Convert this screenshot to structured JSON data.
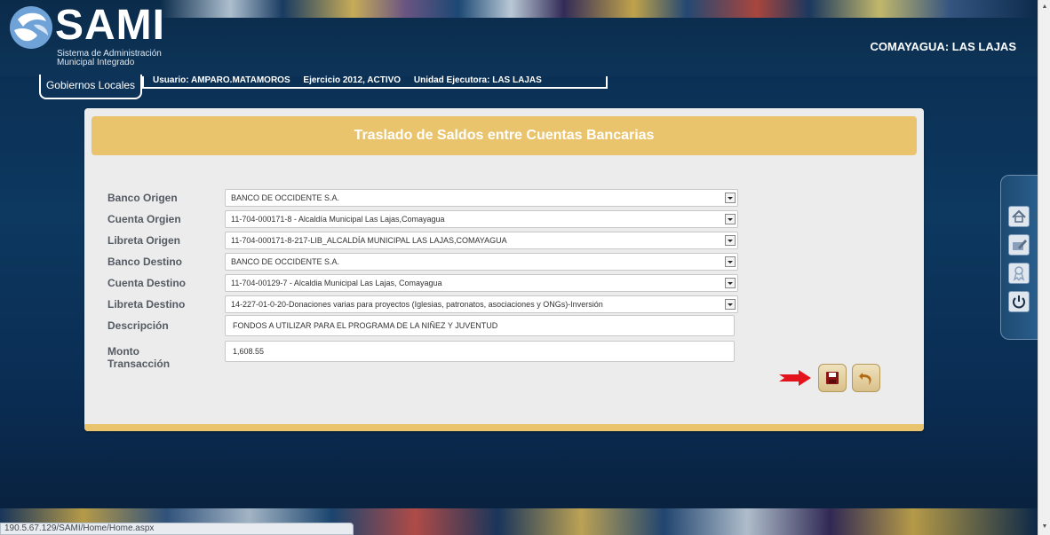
{
  "header": {
    "logo_title": "SAMI",
    "logo_subtitle_1": "Sistema de Administración",
    "logo_subtitle_2": "Municipal Integrado",
    "municipality": "COMAYAGUA: LAS LAJAS"
  },
  "nav": {
    "tab_label": "Gobiernos Locales",
    "usuario": "Usuario: AMPARO.MATAMOROS",
    "ejercicio": "Ejercicio 2012, ACTIVO",
    "unidad": "Unidad Ejecutora: LAS LAJAS"
  },
  "form": {
    "title": "Traslado de Saldos entre Cuentas Bancarias",
    "banco_origen": {
      "label": "Banco Origen",
      "value": "BANCO DE OCCIDENTE S.A."
    },
    "cuenta_origen": {
      "label": "Cuenta Orgien",
      "value": "11-704-000171-8 - Alcaldía Municipal Las Lajas,Comayagua"
    },
    "libreta_origen": {
      "label": "Libreta Origen",
      "value": "11-704-000171-8-217-LIB_ALCALDÍA MUNICIPAL LAS LAJAS,COMAYAGUA"
    },
    "banco_destino": {
      "label": "Banco Destino",
      "value": "BANCO DE OCCIDENTE S.A."
    },
    "cuenta_destino": {
      "label": "Cuenta Destino",
      "value": "11-704-00129-7 - Alcaldia Municipal Las Lajas, Comayagua"
    },
    "libreta_destino": {
      "label": "Libreta Destino",
      "value": "14-227-01-0-20-Donaciones varias para proyectos (Iglesias, patronatos, asociaciones y ONGs)-Inversión"
    },
    "descripcion": {
      "label": "Descripción",
      "value": "FONDOS A UTILIZAR PARA EL PROGRAMA DE LA NIÑEZ Y JUVENTUD"
    },
    "monto": {
      "label": "Monto Transacción",
      "value": "1,608.55"
    }
  },
  "icons": {
    "save": "save-icon",
    "back": "undo-icon",
    "pointer": "red-arrow-icon",
    "toolbar": [
      "home-icon",
      "edit-icon",
      "award-icon",
      "power-icon"
    ]
  },
  "status": {
    "url": "190.5.67.129/SAMI/Home/Home.aspx"
  },
  "colors": {
    "background": "#0d3458",
    "panel": "#ececec",
    "accent_gold": "#e9c46c",
    "arrow_red": "#e3141b"
  }
}
